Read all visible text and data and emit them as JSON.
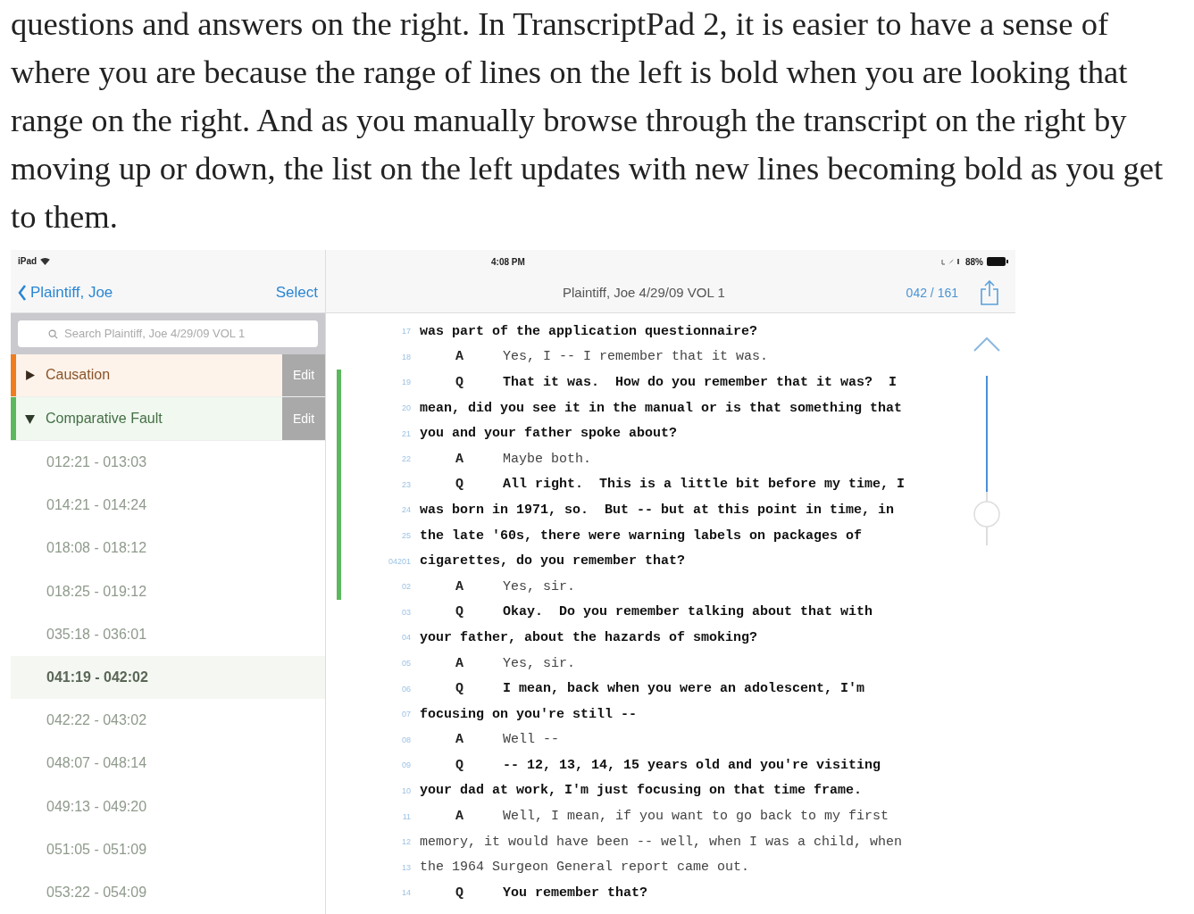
{
  "article": {
    "paragraph": "questions and answers on the right. In TranscriptPad 2, it is easier to have a sense of where you are because the range of lines on the left is bold when you are looking that range on the right. And as you manually browse through the transcript on the right by moving up or down, the list on the left updates with new lines becoming bold as you get to them."
  },
  "screenshot": {
    "status_bar": {
      "device": "iPad",
      "time": "4:08 PM",
      "battery": "88%"
    },
    "sidebar": {
      "back": "Plaintiff, Joe",
      "action": "Select",
      "search": {
        "placeholder": "Search Plaintiff, Joe 4/29/09 VOL 1"
      },
      "topics": [
        {
          "label": "Causation",
          "color": "#f07c1e",
          "expanded": false,
          "edit": "Edit"
        },
        {
          "label": "Comparative Fault",
          "color": "#5cb85c",
          "expanded": true,
          "edit": "Edit",
          "children": [
            {
              "label": "012:21 - 013:03",
              "selected": false
            },
            {
              "label": "014:21 - 014:24",
              "selected": false
            },
            {
              "label": "018:08 - 018:12",
              "selected": false
            },
            {
              "label": "018:25 - 019:12",
              "selected": false
            },
            {
              "label": "035:18 - 036:01",
              "selected": false
            },
            {
              "label": "041:19 - 042:02",
              "selected": true
            },
            {
              "label": "042:22 - 043:02",
              "selected": false
            },
            {
              "label": "048:07 - 048:14",
              "selected": false
            },
            {
              "label": "049:13 - 049:20",
              "selected": false
            },
            {
              "label": "051:05 - 051:09",
              "selected": false
            },
            {
              "label": "053:22 - 054:09",
              "selected": false
            }
          ]
        }
      ]
    },
    "transcript": {
      "title": "Plaintiff, Joe 4/29/09 VOL 1",
      "page_count": "042 / 161",
      "lines": [
        {
          "number": "17",
          "text": "was part of the application questionnaire?",
          "bold": true,
          "marked": false
        },
        {
          "number": "18",
          "speaker": "A",
          "text": "Yes, I -- I remember that it was.",
          "bold": false,
          "marked": false
        },
        {
          "number": "19",
          "speaker": "Q",
          "text": "That it was.  How do you remember that it was?  I",
          "bold": true,
          "marked": true
        },
        {
          "number": "20",
          "text": "mean, did you see it in the manual or is that something that",
          "bold": true,
          "marked": true
        },
        {
          "number": "21",
          "text": "you and your father spoke about?",
          "bold": true,
          "marked": true
        },
        {
          "number": "22",
          "speaker": "A",
          "text": "Maybe both.",
          "bold": false,
          "marked": true
        },
        {
          "number": "23",
          "speaker": "Q",
          "text": "All right.  This is a little bit before my time, I",
          "bold": true,
          "marked": true
        },
        {
          "number": "24",
          "text": "was born in 1971, so.  But -- but at this point in time, in",
          "bold": true,
          "marked": true
        },
        {
          "number": "25",
          "text": "the late '60s, there were warning labels on packages of",
          "bold": true,
          "marked": true
        },
        {
          "page": "042",
          "number": "01",
          "text": "cigarettes, do you remember that?",
          "bold": true,
          "marked": true
        },
        {
          "number": "02",
          "speaker": "A",
          "text": "Yes, sir.",
          "bold": false,
          "marked": true
        },
        {
          "number": "03",
          "speaker": "Q",
          "text": "Okay.  Do you remember talking about that with",
          "bold": true,
          "marked": false
        },
        {
          "number": "04",
          "text": "your father, about the hazards of smoking?",
          "bold": true,
          "marked": false
        },
        {
          "number": "05",
          "speaker": "A",
          "text": "Yes, sir.",
          "bold": false,
          "marked": false
        },
        {
          "number": "06",
          "speaker": "Q",
          "text": "I mean, back when you were an adolescent, I'm",
          "bold": true,
          "marked": false
        },
        {
          "number": "07",
          "text": "focusing on you're still --",
          "bold": true,
          "marked": false
        },
        {
          "number": "08",
          "speaker": "A",
          "text": "Well --",
          "bold": false,
          "marked": false
        },
        {
          "number": "09",
          "speaker": "Q",
          "text": "-- 12, 13, 14, 15 years old and you're visiting",
          "bold": true,
          "marked": false
        },
        {
          "number": "10",
          "text": "your dad at work, I'm just focusing on that time frame.",
          "bold": true,
          "marked": false
        },
        {
          "number": "11",
          "speaker": "A",
          "text": "Well, I mean, if you want to go back to my first",
          "bold": false,
          "marked": false
        },
        {
          "number": "12",
          "text": "memory, it would have been -- well, when I was a child, when",
          "bold": false,
          "marked": false
        },
        {
          "number": "13",
          "text": "the 1964 Surgeon General report came out.",
          "bold": false,
          "marked": false
        },
        {
          "number": "14",
          "speaker": "Q",
          "text": "You remember that?",
          "bold": true,
          "marked": false
        }
      ]
    }
  }
}
